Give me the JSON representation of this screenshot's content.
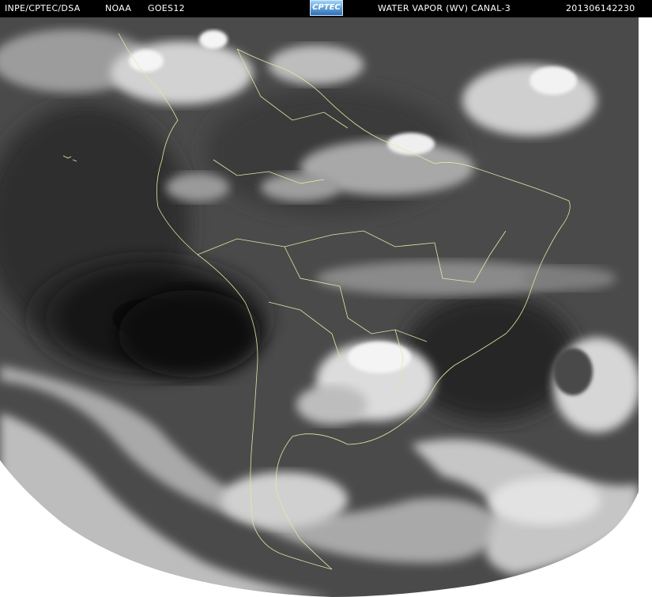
{
  "header": {
    "source": "INPE/CPTEC/DSA",
    "agency": "NOAA",
    "satellite": "GOES12",
    "logo_text": "CPTEC",
    "channel": "WATER VAPOR  (WV)  CANAL-3",
    "timestamp": "201306142230"
  },
  "colors": {
    "header_background": "#000000",
    "header_text": "#ffffff",
    "coastline": "#e8e6a8",
    "space_background": "#ffffff"
  }
}
